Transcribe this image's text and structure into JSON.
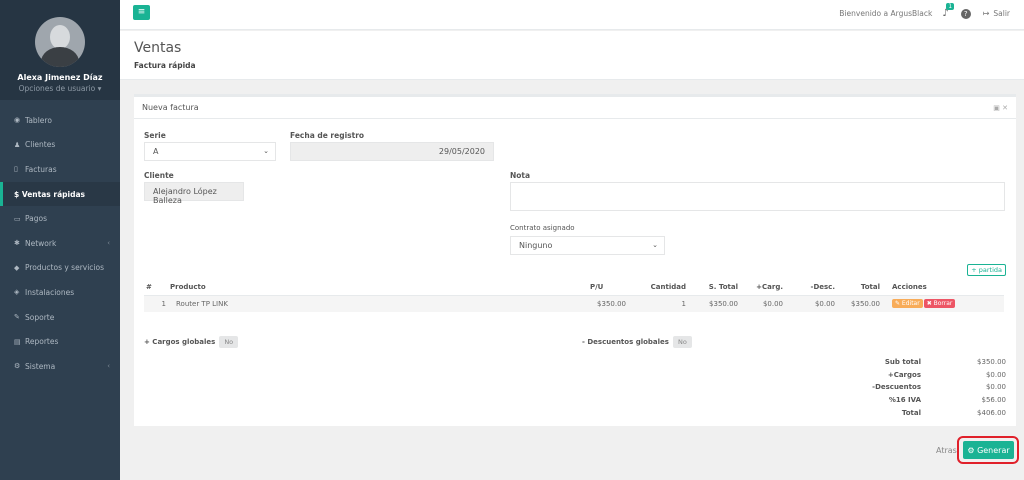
{
  "sidebar": {
    "user_name": "Alexa Jimenez Díaz",
    "user_options": "Opciones de usuario ▾",
    "items": [
      {
        "label": "Tablero",
        "icon": "dashboard-icon"
      },
      {
        "label": "Clientes",
        "icon": "users-icon"
      },
      {
        "label": "Facturas",
        "icon": "file-icon"
      },
      {
        "label": "$ Ventas rápidas",
        "icon": "dollar-icon"
      },
      {
        "label": "Pagos",
        "icon": "money-icon"
      },
      {
        "label": "Network",
        "icon": "network-icon"
      },
      {
        "label": "Productos y servicios",
        "icon": "tag-icon"
      },
      {
        "label": "Instalaciones",
        "icon": "wrench-icon"
      },
      {
        "label": "Soporte",
        "icon": "support-icon"
      },
      {
        "label": "Reportes",
        "icon": "report-icon"
      },
      {
        "label": "Sistema",
        "icon": "cogs-icon"
      }
    ]
  },
  "topbar": {
    "welcome": "Bienvenido a ArgusBlack",
    "notif_count": "1",
    "logout": "Salir"
  },
  "heading": {
    "title": "Ventas",
    "breadcrumb": "Factura rápida"
  },
  "panel": {
    "title": "Nueva factura",
    "serie_label": "Serie",
    "serie_value": "A",
    "fecha_label": "Fecha de registro",
    "fecha_value": "29/05/2020",
    "cliente_label": "Cliente",
    "cliente_value": "Alejandro López Balleza",
    "nota_label": "Nota",
    "contrato_label": "Contrato asignado",
    "contrato_value": "Ninguno",
    "partida_label": "+ partida"
  },
  "table": {
    "headers": [
      "#",
      "Producto",
      "P/U",
      "Cantidad",
      "S. Total",
      "+Carg.",
      "-Desc.",
      "Total",
      "Acciones"
    ],
    "rows": [
      [
        "1",
        "Router TP LINK",
        "$350.00",
        "1",
        "$350.00",
        "$0.00",
        "$0.00",
        "$350.00"
      ]
    ],
    "edit_label": "✎ Editar",
    "delete_label": "✖ Borrar"
  },
  "globals": {
    "cargos_label": "+ Cargos globales",
    "cargos_value": "No",
    "descuentos_label": "- Descuentos globales",
    "descuentos_value": "No"
  },
  "totals": [
    {
      "label": "Sub total",
      "value": "$350.00"
    },
    {
      "label": "+Cargos",
      "value": "$0.00"
    },
    {
      "label": "-Descuentos",
      "value": "$0.00"
    },
    {
      "label": "%16 IVA",
      "value": "$56.00"
    },
    {
      "label": "Total",
      "value": "$406.00"
    }
  ],
  "footer": {
    "back_label": "Atras",
    "generate_label": "Generar"
  },
  "colors": {
    "accent": "#1ab394",
    "sidebar": "#2f4050",
    "highlight": "#e0202a"
  }
}
